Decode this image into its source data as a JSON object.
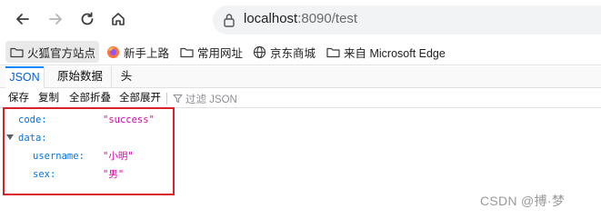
{
  "browser": {
    "url_host": "localhost",
    "url_rest": ":8090/test",
    "icons": {
      "back": "arrow-left-icon",
      "forward": "arrow-right-icon",
      "reload": "reload-icon",
      "home": "home-icon",
      "info": "info-icon"
    }
  },
  "bookmarks": [
    {
      "label": "火狐官方站点",
      "icon": "folder-icon",
      "active": true
    },
    {
      "label": "新手上路",
      "icon": "firefox-icon",
      "active": false
    },
    {
      "label": "常用网址",
      "icon": "folder-icon",
      "active": false
    },
    {
      "label": "京东商城",
      "icon": "globe-icon",
      "active": false
    },
    {
      "label": "来自 Microsoft Edge",
      "icon": "folder-icon",
      "active": false
    }
  ],
  "viewer_tabs": [
    {
      "label": "JSON",
      "selected": true
    },
    {
      "label": "原始数据",
      "selected": false
    },
    {
      "label": "头",
      "selected": false
    }
  ],
  "toolbar": {
    "save": "保存",
    "copy": "复制",
    "collapse_all": "全部折叠",
    "expand_all": "全部展开",
    "filter_placeholder": "过滤 JSON"
  },
  "json": {
    "code_key": "code:",
    "code_value": "\"success\"",
    "data_key": "data:",
    "username_key": "username:",
    "username_value": "\"小明\"",
    "sex_key": "sex:",
    "sex_value": "\"男\""
  },
  "watermark": "CSDN @搏·梦",
  "colors": {
    "json_key": "#0074e8",
    "json_string": "#dd00a9",
    "selected_tab": "#0a84ff",
    "highlight_box": "#d92128"
  }
}
